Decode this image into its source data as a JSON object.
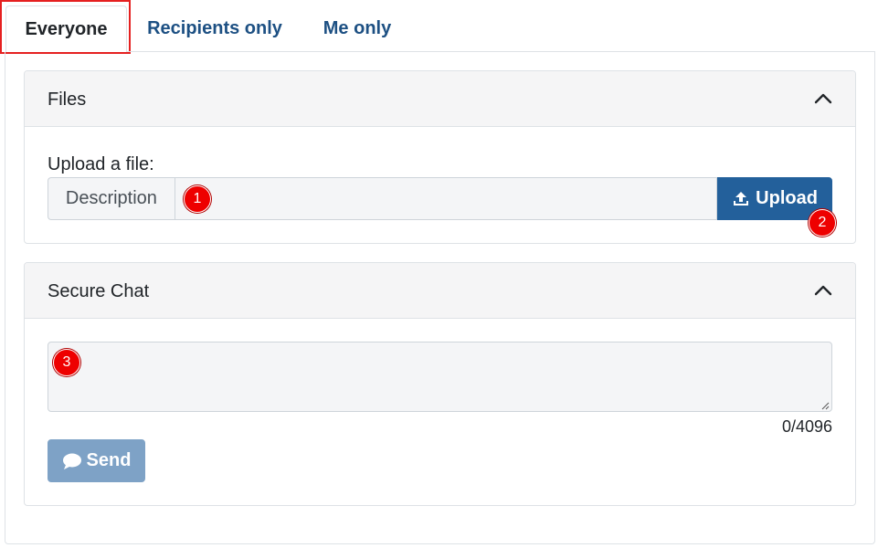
{
  "tabs": [
    {
      "label": "Everyone",
      "active": true
    },
    {
      "label": "Recipients only",
      "active": false
    },
    {
      "label": "Me only",
      "active": false
    }
  ],
  "files": {
    "title": "Files",
    "upload_label": "Upload a file:",
    "description_addon": "Description",
    "description_value": "",
    "upload_button": "Upload"
  },
  "chat": {
    "title": "Secure Chat",
    "message_value": "",
    "counter": "0/4096",
    "send_button": "Send"
  },
  "markers": [
    "1",
    "2",
    "3"
  ],
  "colors": {
    "accent": "#23609b",
    "send_disabled": "#7ea2c6",
    "marker": "#ee0000",
    "active_tab_outline": "#e52020"
  },
  "icons": {
    "collapse": "chevron-up-icon",
    "upload": "upload-icon",
    "send": "chat-bubble-icon"
  }
}
